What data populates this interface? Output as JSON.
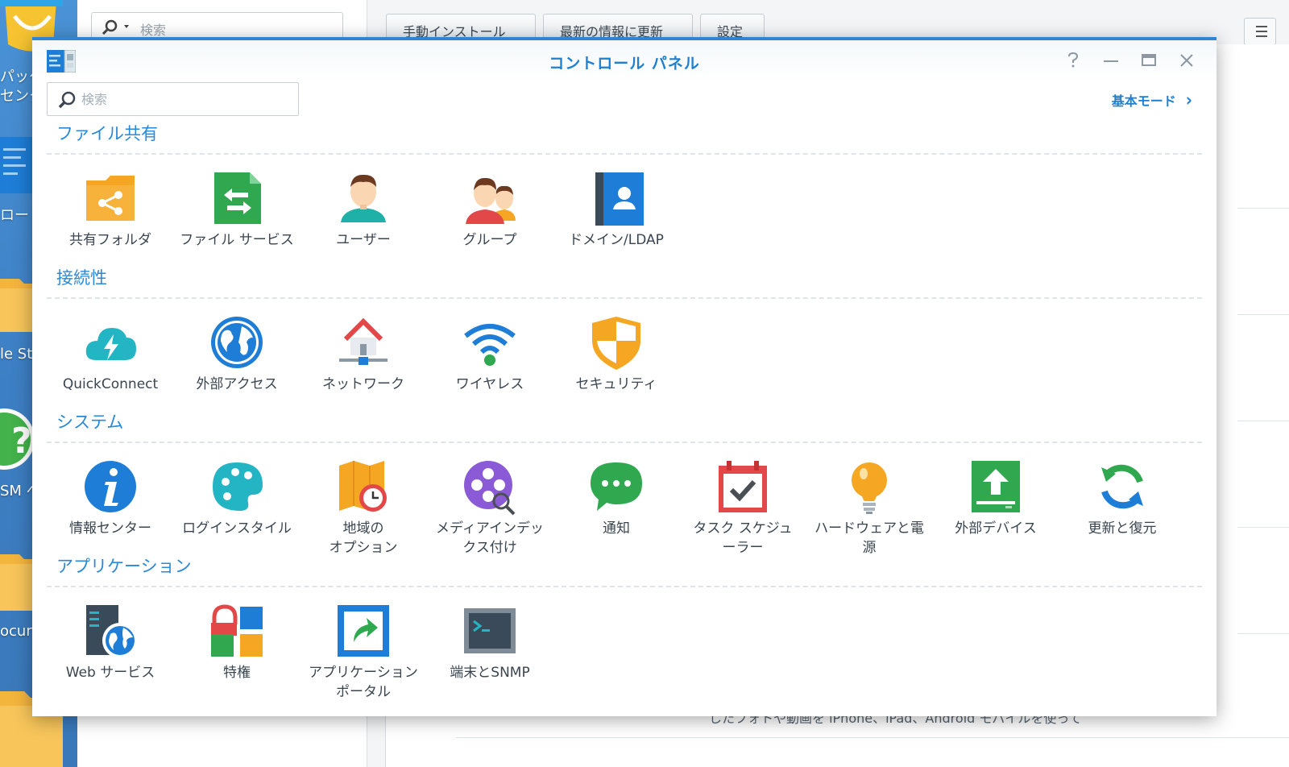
{
  "desktop": {
    "labels": [
      "パッケ\nセンタ",
      "ロー",
      "le St",
      "SM へ",
      "ocur"
    ]
  },
  "background_window": {
    "search_placeholder": "検索",
    "buttons": [
      "手動インストール",
      "最新の情報に更新",
      "設定"
    ],
    "footer_text": "したフォトや動画を iPhone、iPad、Android モバイルを使って"
  },
  "window": {
    "title": "コントロール パネル",
    "controls": [
      "help-icon",
      "minimize-icon",
      "maximize-icon",
      "close-icon"
    ],
    "search_placeholder": "検索",
    "basic_mode_label": "基本モード",
    "accent_color": "#2f85d3"
  },
  "sections": [
    {
      "title": "ファイル共有",
      "items": [
        {
          "label": "共有フォルダ",
          "icon": "shared-folder-icon"
        },
        {
          "label": "ファイル サービス",
          "icon": "file-services-icon"
        },
        {
          "label": "ユーザー",
          "icon": "user-icon"
        },
        {
          "label": "グループ",
          "icon": "group-icon"
        },
        {
          "label": "ドメイン/LDAP",
          "icon": "domain-ldap-icon"
        }
      ]
    },
    {
      "title": "接続性",
      "items": [
        {
          "label": "QuickConnect",
          "icon": "quickconnect-icon"
        },
        {
          "label": "外部アクセス",
          "icon": "external-access-icon"
        },
        {
          "label": "ネットワーク",
          "icon": "network-icon"
        },
        {
          "label": "ワイヤレス",
          "icon": "wireless-icon"
        },
        {
          "label": "セキュリティ",
          "icon": "security-icon"
        }
      ]
    },
    {
      "title": "システム",
      "items": [
        {
          "label": "情報センター",
          "icon": "info-center-icon"
        },
        {
          "label": "ログインスタイル",
          "icon": "login-style-icon"
        },
        {
          "label": "地域の\nオプション",
          "icon": "regional-options-icon"
        },
        {
          "label": "メディアインデッ\nクス付け",
          "icon": "media-indexing-icon"
        },
        {
          "label": "通知",
          "icon": "notification-icon"
        },
        {
          "label": "タスク スケジュ\nーラー",
          "icon": "task-scheduler-icon"
        },
        {
          "label": "ハードウェアと電\n源",
          "icon": "hardware-power-icon"
        },
        {
          "label": "外部デバイス",
          "icon": "external-devices-icon"
        },
        {
          "label": "更新と復元",
          "icon": "update-restore-icon"
        }
      ]
    },
    {
      "title": "アプリケーション",
      "items": [
        {
          "label": "Web サービス",
          "icon": "web-services-icon"
        },
        {
          "label": "特権",
          "icon": "privileges-icon"
        },
        {
          "label": "アプリケーション\nポータル",
          "icon": "application-portal-icon"
        },
        {
          "label": "端末とSNMP",
          "icon": "terminal-snmp-icon"
        }
      ]
    }
  ]
}
